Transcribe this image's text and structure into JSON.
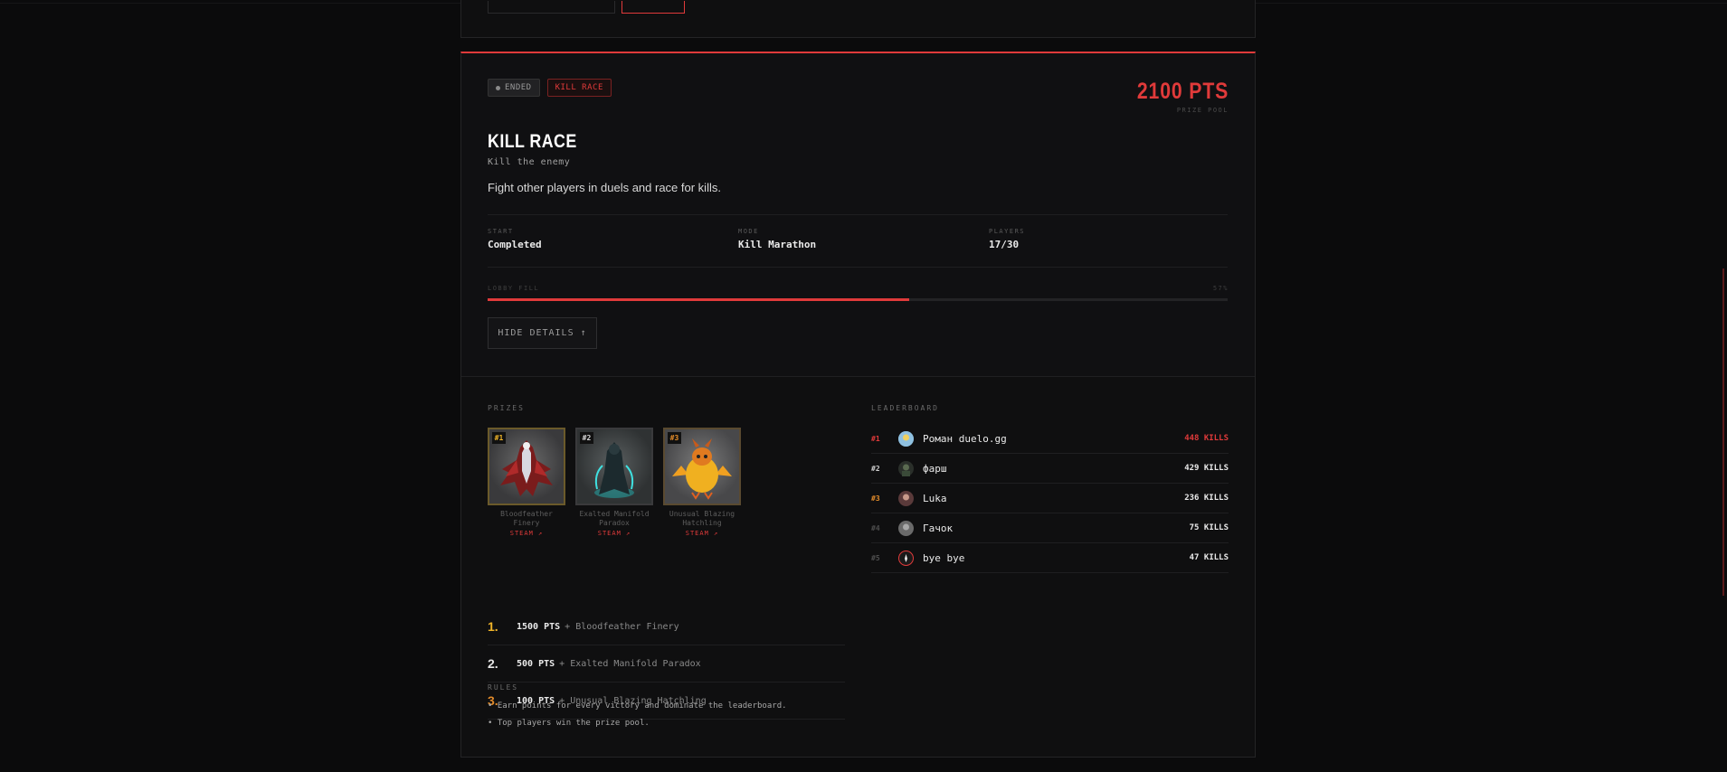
{
  "card": {
    "status_badge": "ENDED",
    "type_badge": "KILL RACE",
    "prize_pool": "2100 PTS",
    "prize_pool_label": "PRIZE POOL",
    "title": "KILL RACE",
    "subtitle": "Kill the enemy",
    "description": "Fight other players in duels and race for kills.",
    "meta": [
      {
        "key": "START",
        "value": "Completed"
      },
      {
        "key": "MODE",
        "value": "Kill Marathon"
      },
      {
        "key": "PLAYERS",
        "value": "17/30"
      }
    ],
    "lobby_fill_label": "LOBBY FILL",
    "lobby_fill_percent": "57%",
    "lobby_fill_fraction": 0.57,
    "hide_details_label": "HIDE DETAILS ↑"
  },
  "prizes": {
    "section_label": "PRIZES",
    "items": [
      {
        "rank": "#1",
        "name": "Bloodfeather Finery",
        "link": "STEAM ↗"
      },
      {
        "rank": "#2",
        "name": "Exalted Manifold Paradox",
        "link": "STEAM ↗"
      },
      {
        "rank": "#3",
        "name": "Unusual Blazing Hatchling",
        "link": "STEAM ↗"
      }
    ],
    "list": [
      {
        "num": "1.",
        "pts": "1500 PTS",
        "item": "+ Bloodfeather Finery"
      },
      {
        "num": "2.",
        "pts": "500 PTS",
        "item": "+ Exalted Manifold Paradox"
      },
      {
        "num": "3.",
        "pts": "100 PTS",
        "item": "+ Unusual Blazing Hatchling"
      }
    ]
  },
  "rules": {
    "section_label": "RULES",
    "items": [
      "• Earn points for every victory and dominate the leaderboard.",
      "• Top players win the prize pool."
    ]
  },
  "leaderboard": {
    "section_label": "LEADERBOARD",
    "rows": [
      {
        "rank": "#1",
        "name": "Роман duelo.gg",
        "kills": "448 KILLS"
      },
      {
        "rank": "#2",
        "name": "фарш",
        "kills": "429 KILLS"
      },
      {
        "rank": "#3",
        "name": "Luka",
        "kills": "236 KILLS"
      },
      {
        "rank": "#4",
        "name": "Гачок",
        "kills": "75 KILLS"
      },
      {
        "rank": "#5",
        "name": "bye bye",
        "kills": "47 KILLS"
      }
    ]
  },
  "colors": {
    "accent": "#e03a3a",
    "gold": "#f0b429",
    "bronze": "#e08a2a"
  }
}
